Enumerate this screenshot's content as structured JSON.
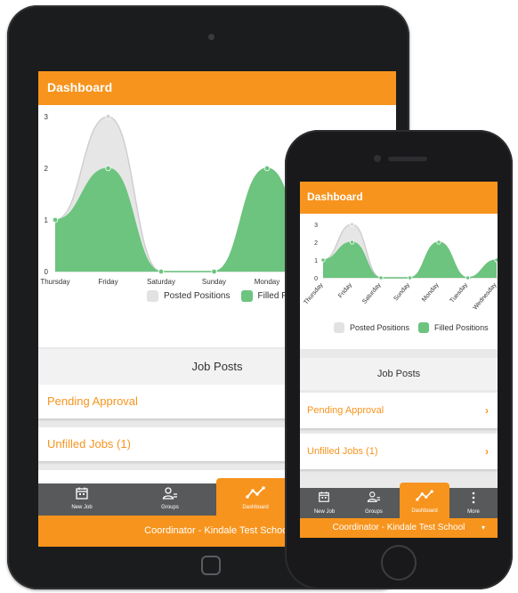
{
  "app": {
    "title": "Dashboard",
    "section_title": "Job Posts",
    "list_items": [
      {
        "label": "Pending Approval"
      },
      {
        "label": "Unfilled Jobs (1)"
      }
    ],
    "tabs": [
      {
        "label": "New Job",
        "icon": "calendar-icon"
      },
      {
        "label": "Groups",
        "icon": "group-icon"
      },
      {
        "label": "Dashboard",
        "icon": "chart-line-icon"
      },
      {
        "label": "More",
        "icon": "more-vertical-icon"
      }
    ],
    "footer": "Coordinator - Kindale Test School",
    "footer_icon": "caret-down-icon"
  },
  "colors": {
    "accent": "#f7941d",
    "tabbar": "#58595b",
    "filled": "#6cc47f",
    "posted": "#e6e6e6"
  },
  "chart_data": {
    "type": "area",
    "categories": [
      "Thursday",
      "Friday",
      "Saturday",
      "Sunday",
      "Monday",
      "Tuesday",
      "Wednesday"
    ],
    "series": [
      {
        "name": "Posted Positions",
        "values": [
          1,
          3,
          0,
          0,
          2,
          0,
          1
        ]
      },
      {
        "name": "Filled Positions",
        "values": [
          1,
          2,
          0,
          0,
          2,
          0,
          1
        ]
      }
    ],
    "ylim": [
      0,
      3
    ],
    "yticks": [
      "0",
      "1",
      "2",
      "3"
    ],
    "tablet_legend": [
      "Posted Positions",
      "Filled Positi"
    ],
    "legend_position": "bottom-center",
    "grid": false
  }
}
